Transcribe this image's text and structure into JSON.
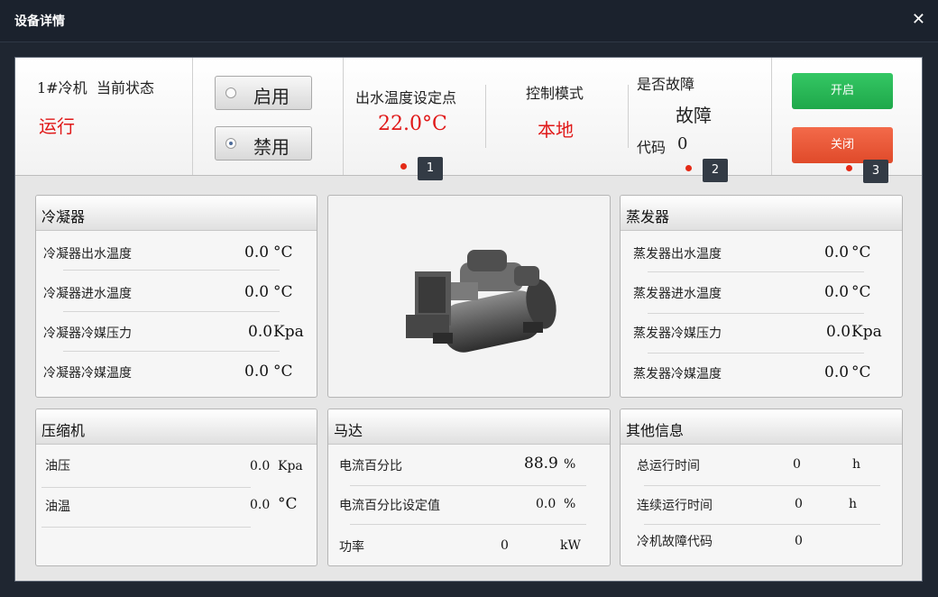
{
  "window": {
    "title": "设备详情",
    "close_icon": "close-icon"
  },
  "status": {
    "unit_name": "1#冷机",
    "current_state_label": "当前状态",
    "state_value": "运行",
    "mode_enable_label": "启用",
    "mode_disable_label": "禁用",
    "mode_selected": "禁用",
    "setpoint_label": "出水温度设定点",
    "setpoint_value": "22.0°C",
    "control_mode_label": "控制模式",
    "control_mode_value": "本地",
    "fault_label": "是否故障",
    "fault_value": "故障",
    "code_label": "代码",
    "code_value": "0",
    "start_label": "开启",
    "stop_label": "关闭"
  },
  "markers": [
    "1",
    "2",
    "3"
  ],
  "condenser": {
    "title": "冷凝器",
    "rows": [
      {
        "label": "冷凝器出水温度",
        "value": "0.0",
        "unit": "°C"
      },
      {
        "label": "冷凝器进水温度",
        "value": "0.0",
        "unit": "°C"
      },
      {
        "label": "冷凝器冷媒压力",
        "value": "0.0",
        "unit": "Kpa"
      },
      {
        "label": "冷凝器冷媒温度",
        "value": "0.0",
        "unit": "°C"
      }
    ]
  },
  "evaporator": {
    "title": "蒸发器",
    "rows": [
      {
        "label": "蒸发器出水温度",
        "value": "0.0",
        "unit": "°C"
      },
      {
        "label": "蒸发器进水温度",
        "value": "0.0",
        "unit": "°C"
      },
      {
        "label": "蒸发器冷媒压力",
        "value": "0.0",
        "unit": "Kpa"
      },
      {
        "label": "蒸发器冷媒温度",
        "value": "0.0",
        "unit": "°C"
      }
    ]
  },
  "compressor": {
    "title": "压缩机",
    "rows": [
      {
        "label": "油压",
        "value": "0.0",
        "unit": "Kpa"
      },
      {
        "label": "油温",
        "value": "0.0",
        "unit": "°C"
      }
    ]
  },
  "motor": {
    "title": "马达",
    "rows": [
      {
        "label": "电流百分比",
        "value": "88.9",
        "unit": "%"
      },
      {
        "label": "电流百分比设定值",
        "value": "0.0",
        "unit": "%"
      },
      {
        "label": "功率",
        "value": "0",
        "unit": "kW"
      }
    ]
  },
  "other": {
    "title": "其他信息",
    "rows": [
      {
        "label": "总运行时间",
        "value": "0",
        "unit": "h"
      },
      {
        "label": "连续运行时间",
        "value": "0",
        "unit": "h"
      },
      {
        "label": "冷机故障代码",
        "value": "0",
        "unit": ""
      }
    ]
  },
  "colors": {
    "accent_red": "#e01818",
    "start_green": "#27b556",
    "stop_red": "#ea5533"
  }
}
